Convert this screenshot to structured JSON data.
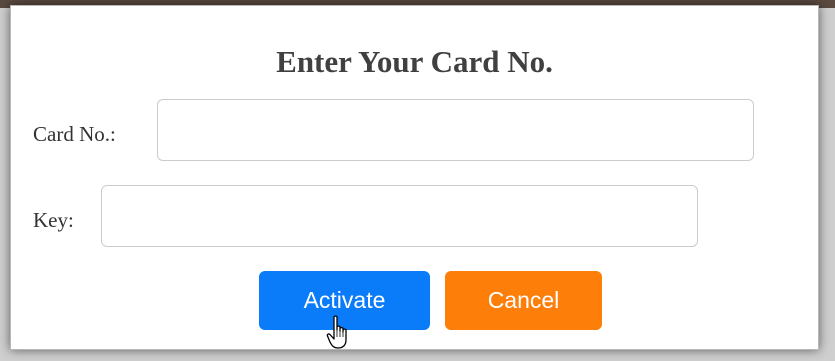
{
  "dialog": {
    "title": "Enter Your Card No.",
    "card_label": "Card No.:",
    "card_value": "",
    "key_label": "Key:",
    "key_value": "",
    "activate_label": "Activate",
    "cancel_label": "Cancel"
  },
  "colors": {
    "activate": "#0a7cf9",
    "cancel": "#fd7e09",
    "title": "#404040"
  },
  "icons": {
    "cursor": "hand-pointer-icon"
  }
}
